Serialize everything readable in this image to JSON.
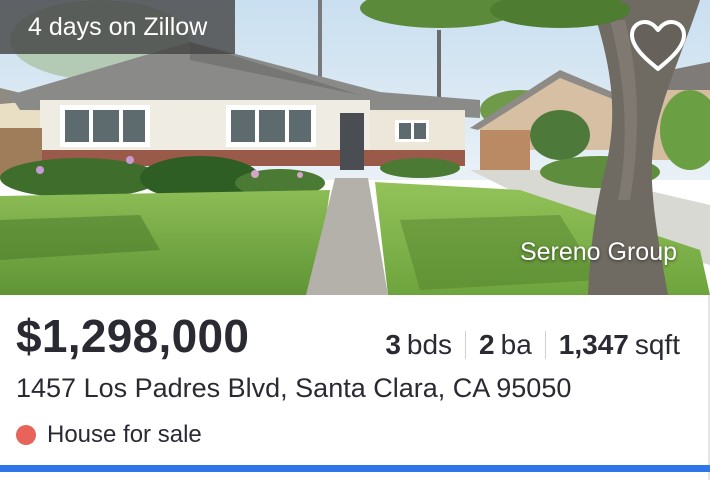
{
  "listing": {
    "days_on_site": "4 days on Zillow",
    "favorite_icon": "heart-outline-icon",
    "photo_credit": "Sereno Group",
    "price": "$1,298,000",
    "beds": "3",
    "beds_unit": "bds",
    "baths": "2",
    "baths_unit": "ba",
    "area": "1,347",
    "area_unit": "sqft",
    "address": "1457 Los Padres Blvd, Santa Clara, CA 95050",
    "status": "House for sale"
  },
  "colors": {
    "status_dot": "#e8635a",
    "accent_bar": "#2e75e8",
    "text": "#2a2a33"
  }
}
